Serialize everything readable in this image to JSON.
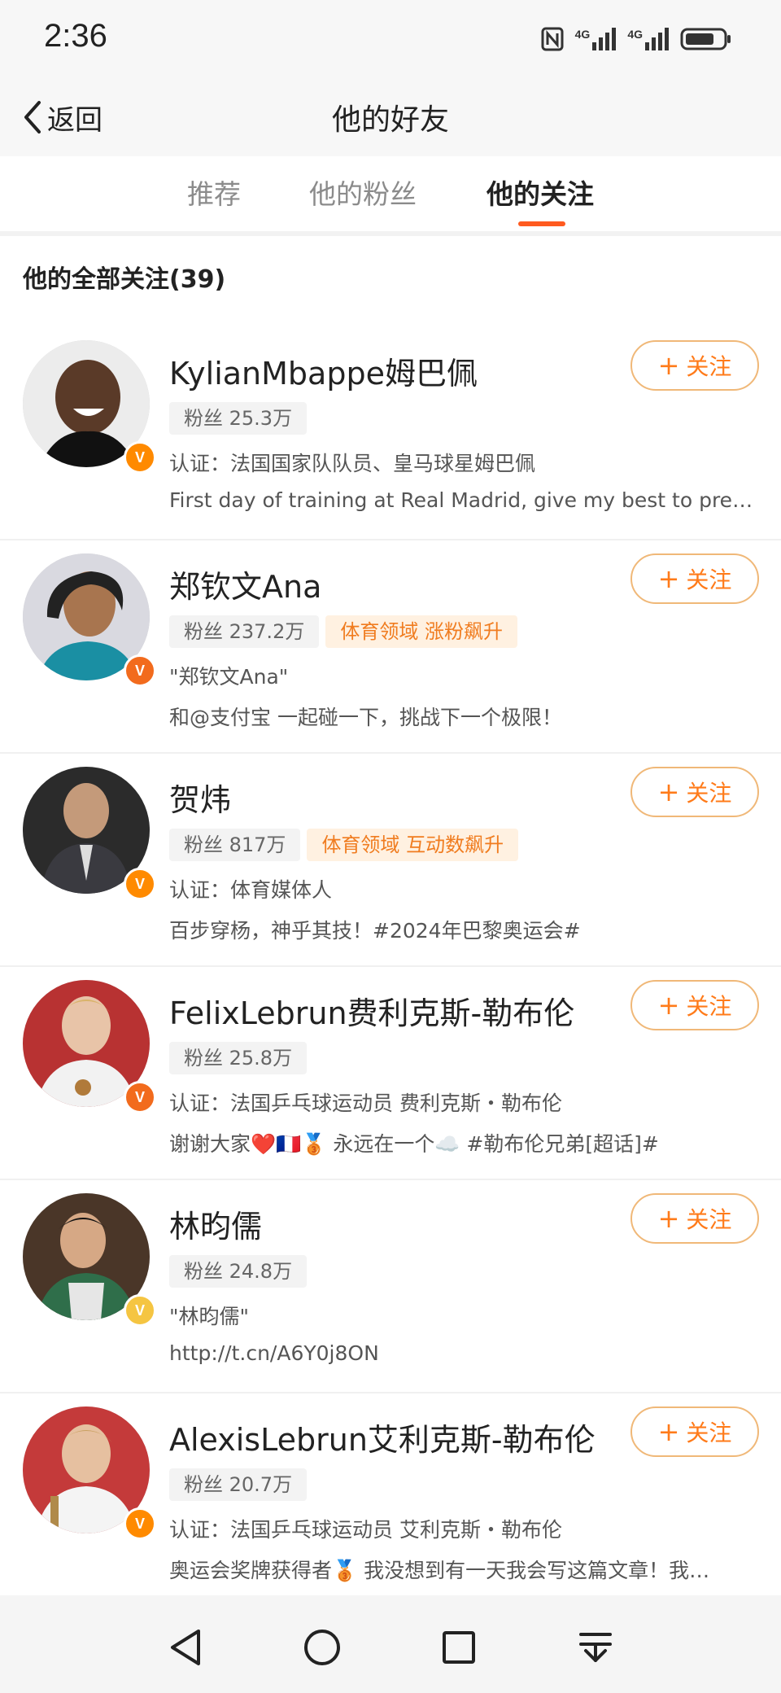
{
  "status_bar": {
    "time": "2:36",
    "signal_1": "4G",
    "signal_2": "4G"
  },
  "header": {
    "back_label": "返回",
    "title": "他的好友"
  },
  "tabs": [
    {
      "label": "推荐",
      "active": false
    },
    {
      "label": "他的粉丝",
      "active": false
    },
    {
      "label": "他的关注",
      "active": true
    }
  ],
  "section": {
    "title": "他的全部关注(39)"
  },
  "follow_label": "关注",
  "users": [
    {
      "name": "KylianMbappe姆巴佩",
      "fans": "粉丝 25.3万",
      "tag": "",
      "desc": "认证：法国国家队队员、皇马球星姆巴佩",
      "intro": "First day of training at Real Madrid, give my best to prep…",
      "verify_color": "#ff8a00"
    },
    {
      "name": "郑钦文Ana",
      "fans": "粉丝 237.2万",
      "tag": "体育领域 涨粉飙升",
      "desc": "\"郑钦文Ana\"",
      "intro": "和@支付宝 一起碰一下，挑战下一个极限！",
      "verify_color": "#f26b1d"
    },
    {
      "name": "贺炜",
      "fans": "粉丝 817万",
      "tag": "体育领域 互动数飙升",
      "desc": "认证：体育媒体人",
      "intro": "百步穿杨，神乎其技！#2024年巴黎奥运会#",
      "verify_color": "#ff8a00"
    },
    {
      "name": "FelixLebrun费利克斯-勒布伦",
      "fans": "粉丝 25.8万",
      "tag": "",
      "desc": "认证：法国乒乓球运动员 费利克斯・勒布伦",
      "intro": "谢谢大家❤️🇫🇷🥉 永远在一个☁️ #勒布伦兄弟[超话]#",
      "verify_color": "#f26b1d"
    },
    {
      "name": "林昀儒",
      "fans": "粉丝 24.8万",
      "tag": "",
      "desc": "\"林昀儒\"",
      "intro": "http://t.cn/A6Y0j8ON",
      "verify_color": "#f5c542"
    },
    {
      "name": "AlexisLebrun艾利克斯-勒布伦",
      "fans": "粉丝 20.7万",
      "tag": "",
      "desc": "认证：法国乒乓球运动员 艾利克斯・勒布伦",
      "intro": "奥运会奖牌获得者🥉 我没想到有一天我会写这篇文章！我…",
      "verify_color": "#ff8a00"
    }
  ],
  "avatar_colors": [
    "#e9e9e9",
    "#7fb9c9",
    "#3a3a3a",
    "#c23030",
    "#5a4030",
    "#b83a3a"
  ],
  "icons": {
    "back": "chevron-left-icon",
    "nav_back": "triangle-back-icon",
    "nav_home": "circle-home-icon",
    "nav_recent": "square-recent-icon",
    "nav_menu": "menu-down-icon"
  },
  "colors": {
    "accent": "#ff5a1f",
    "follow_text": "#ff7b1a"
  }
}
